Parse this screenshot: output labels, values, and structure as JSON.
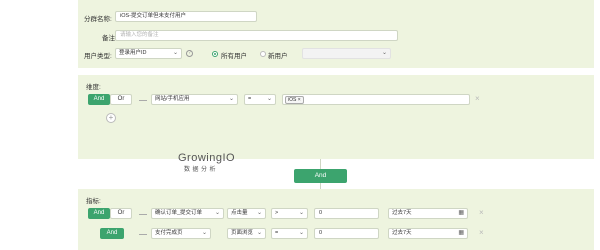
{
  "group": {
    "name_label": "分群名称:",
    "name_value": "iOS-提交订单但未支付用户",
    "remark_label": "备注:",
    "remark_placeholder": "请输入您的备注",
    "user_type_label": "用户类型:",
    "user_type_value": "登录用户ID",
    "help_glyph": "?",
    "radio_all": "所有用户",
    "radio_new": "新用户"
  },
  "dimension": {
    "label": "维度:",
    "and": "And",
    "or": "Or",
    "field": "网站/手机应用",
    "operator": "=",
    "tag": "iOS",
    "tag_close": "×",
    "remove": "×",
    "add": "+"
  },
  "logo": {
    "main": "GrowingIO",
    "sub": "数据分析"
  },
  "center_and": "And",
  "metrics": {
    "label": "指标:",
    "row1": {
      "and": "And",
      "or": "Or",
      "event": "确认订单_提交订单",
      "measure": "点击量",
      "op": ">",
      "value": "0",
      "range": "过去7天",
      "remove": "×"
    },
    "row2": {
      "and": "And",
      "event": "支付完成页",
      "measure": "页面浏览",
      "op": "=",
      "value": "0",
      "range": "过去7天",
      "remove": "×"
    }
  },
  "icons": [
    "calendar-icon",
    "caret-down-icon",
    "plus-icon",
    "close-icon",
    "help-icon"
  ],
  "colors": {
    "panel": "#eef4df",
    "accent": "#3ca46e"
  }
}
